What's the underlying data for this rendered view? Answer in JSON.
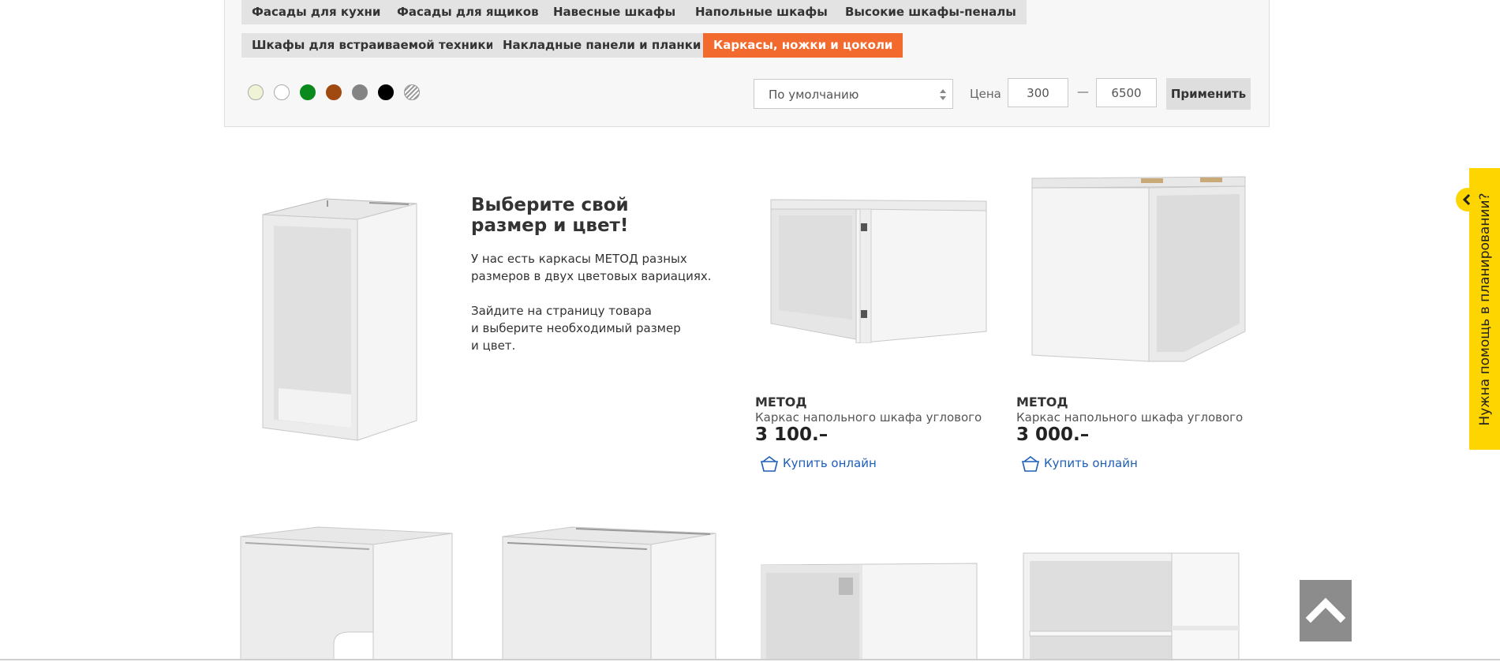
{
  "filters": {
    "categories": [
      {
        "label": "Фасады для кухни",
        "active": false
      },
      {
        "label": "Фасады для ящиков",
        "active": false
      },
      {
        "label": "Навесные шкафы",
        "active": false
      },
      {
        "label": "Напольные шкафы",
        "active": false
      },
      {
        "label": "Высокие шкафы-пеналы",
        "active": false
      },
      {
        "label": "Шкафы для встраиваемой техники",
        "active": false
      },
      {
        "label": "Накладные панели и планки",
        "active": false
      },
      {
        "label": "Каркасы, ножки и цоколи",
        "active": true
      }
    ],
    "colors": [
      "#f1f3d6",
      "#ffffff",
      "#0a8a1c",
      "#a04a12",
      "#848484",
      "#000000",
      "striped"
    ],
    "sort": {
      "selected": "По умолчанию"
    },
    "price": {
      "label": "Цена",
      "min": "300",
      "max": "6500",
      "dash": "—"
    },
    "apply_label": "Применить"
  },
  "promo": {
    "title_line1": "Выберите свой",
    "title_line2": "размер и цвет!",
    "text1_line1": "У нас есть каркасы МЕТОД разных",
    "text1_line2": "размеров в двух цветовых вариациях.",
    "text2_line1": "Зайдите на страницу товара",
    "text2_line2": "и выберите необходимый размер",
    "text2_line3": "и цвет."
  },
  "products": [
    {
      "brand": "МЕТОД",
      "description": "Каркас напольного шкафа углового",
      "price": "3 100.–",
      "buy_label": "Купить онлайн"
    },
    {
      "brand": "МЕТОД",
      "description": "Каркас напольного шкафа углового",
      "price": "3 000.–",
      "buy_label": "Купить онлайн"
    }
  ],
  "help": {
    "label": "Нужна помощь в планировании?"
  },
  "icons": {
    "buy": "basket-icon",
    "sort": "sort-arrows-icon",
    "help_toggle": "chevron-left-icon",
    "scroll_top": "chevron-up-icon"
  },
  "colors": {
    "accent": "#f26a2e",
    "link": "#1d5fb8",
    "help_tab": "#ffd500",
    "tag_bg": "#e3e3e3",
    "scroll_btn": "#8c8c8c"
  }
}
